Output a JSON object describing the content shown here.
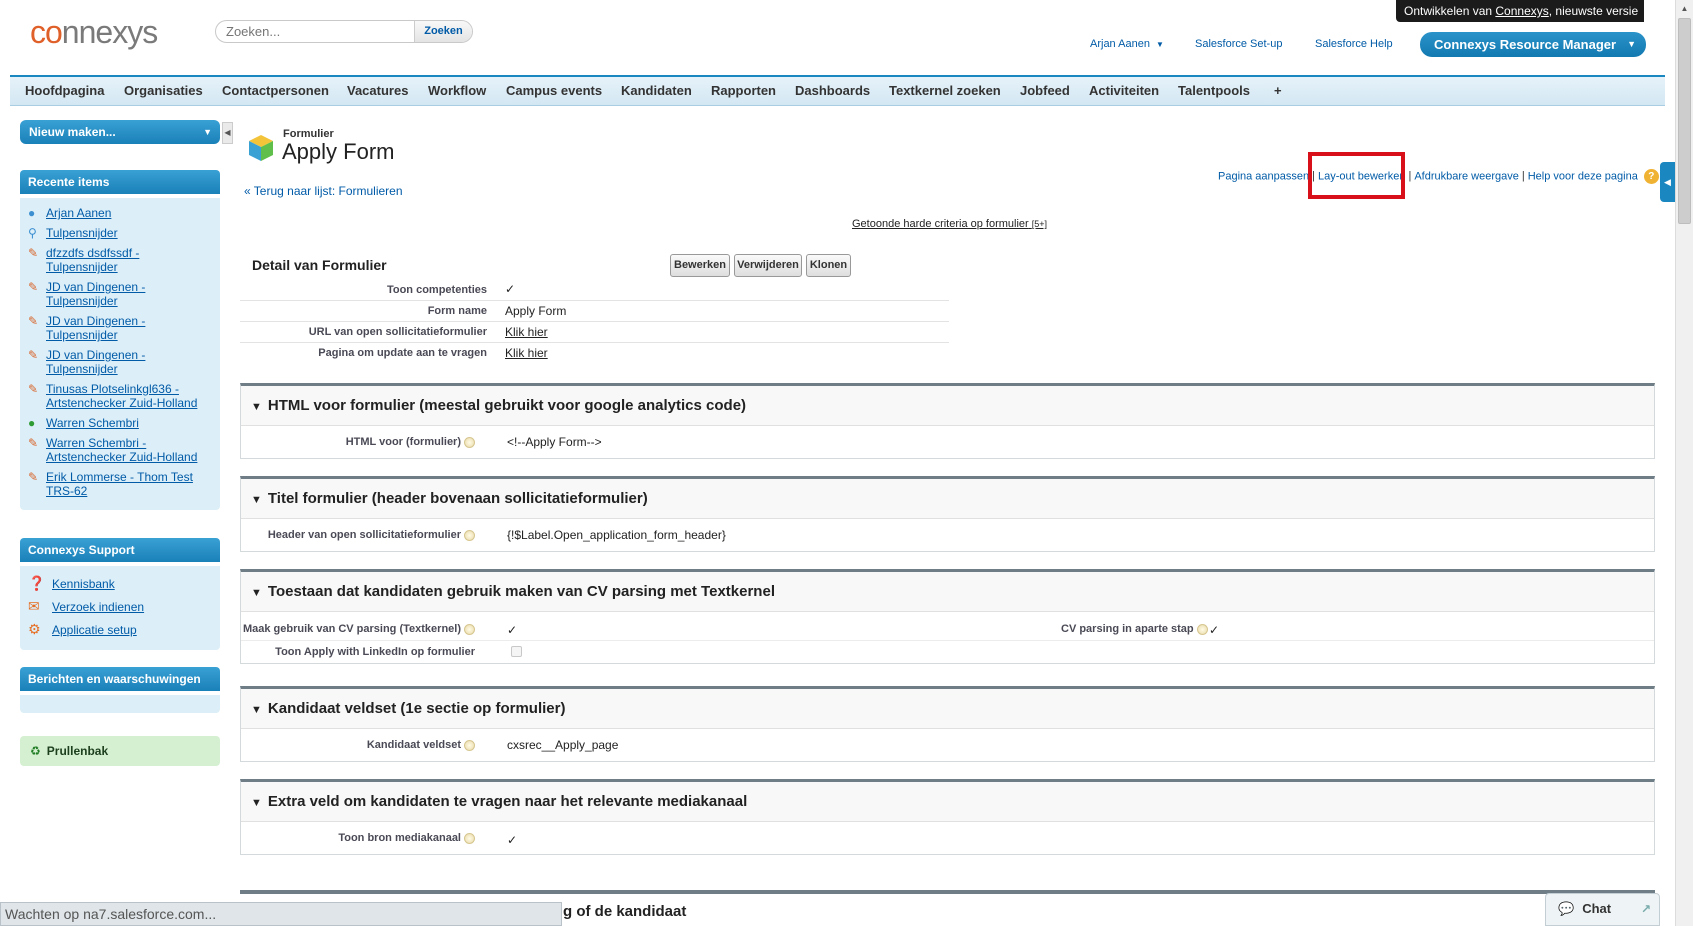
{
  "header": {
    "logo_pre": "co",
    "logo_rest": "nnexys",
    "search_placeholder": "Zoeken...",
    "search_button": "Zoeken",
    "dev_banner_pre": "Ontwikkelen van ",
    "dev_banner_link": "Connexys",
    "dev_banner_post": ", nieuwste versie",
    "user_name": "Arjan Aanen",
    "setup_link": "Salesforce Set-up",
    "help_link": "Salesforce Help",
    "app_menu": "Connexys Resource Manager"
  },
  "tabs": [
    "Hoofdpagina",
    "Organisaties",
    "Contactpersonen",
    "Vacatures",
    "Workflow",
    "Campus events",
    "Kandidaten",
    "Rapporten",
    "Dashboards",
    "Textkernel zoeken",
    "Jobfeed",
    "Activiteiten",
    "Talentpools",
    "+"
  ],
  "sidebar": {
    "new_button": "Nieuw maken...",
    "recent_title": "Recente items",
    "recent_items": [
      {
        "icon": "person-icon",
        "label": "Arjan Aanen"
      },
      {
        "icon": "search-icon",
        "label": "Tulpensnijder"
      },
      {
        "icon": "pencil-icon",
        "label": "dfzzdfs dsdfssdf - Tulpensnijder"
      },
      {
        "icon": "pencil-icon",
        "label": "JD van Dingenen - Tulpensnijder"
      },
      {
        "icon": "pencil-icon",
        "label": "JD van Dingenen - Tulpensnijder"
      },
      {
        "icon": "pencil-icon",
        "label": "JD van Dingenen - Tulpensnijder"
      },
      {
        "icon": "pencil-icon",
        "label": "Tinusas Plotselinkgl636 - Artstenchecker Zuid-Holland"
      },
      {
        "icon": "person-green-icon",
        "label": "Warren Schembri"
      },
      {
        "icon": "pencil-icon",
        "label": "Warren Schembri - Artstenchecker Zuid-Holland"
      },
      {
        "icon": "pencil-icon",
        "label": "Erik Lommerse - Thom Test TRS-62"
      }
    ],
    "support_title": "Connexys Support",
    "support_items": [
      "Kennisbank",
      "Verzoek indienen",
      "Applicatie setup"
    ],
    "messages_title": "Berichten en waarschuwingen",
    "trash_label": "Prullenbak"
  },
  "page": {
    "type_label": "Formulier",
    "title": "Apply Form",
    "back_link": "« Terug naar lijst: Formulieren",
    "links": [
      "Pagina aanpassen",
      "Lay-out bewerken",
      "Afdrukbare weergave",
      "Help voor deze pagina"
    ],
    "criteria_text": "Getoonde harde criteria op formulier",
    "criteria_count": "[5+]",
    "detail_title": "Detail van Formulier",
    "buttons": [
      "Bewerken",
      "Verwijderen",
      "Klonen"
    ],
    "fields": [
      {
        "label": "Toon competenties",
        "value": "✓"
      },
      {
        "label": "Form name",
        "value": "Apply Form"
      },
      {
        "label": "URL van open sollicitatieformulier",
        "value": "Klik hier"
      },
      {
        "label": "Pagina om update aan te vragen",
        "value": "Klik hier"
      }
    ]
  },
  "sections": [
    {
      "title": "HTML voor formulier (meestal gebruikt voor google analytics code)",
      "rows": [
        {
          "label": "HTML voor (formulier)",
          "value": "<!--Apply Form-->"
        }
      ]
    },
    {
      "title": "Titel formulier (header bovenaan sollicitatieformulier)",
      "rows": [
        {
          "label": "Header van open sollicitatieformulier",
          "value": "{!$Label.Open_application_form_header}"
        }
      ]
    },
    {
      "title": "Toestaan dat kandidaten gebruik maken van CV parsing met Textkernel",
      "rows": [
        {
          "label": "Maak gebruik van CV parsing (Textkernel)",
          "value": "✓",
          "label2": "CV parsing in aparte stap",
          "value2": "✓"
        },
        {
          "label": "Toon Apply with LinkedIn op formulier",
          "value": ""
        }
      ]
    },
    {
      "title": "Kandidaat veldset (1e sectie op formulier)",
      "rows": [
        {
          "label": "Kandidaat veldset",
          "value": "cxsrec__Apply_page"
        }
      ]
    },
    {
      "title": "Extra veld om kandidaten te vragen naar het relevante mediakanaal",
      "rows": [
        {
          "label": "Toon bron mediakanaal",
          "value": "✓"
        }
      ]
    }
  ],
  "bottom": {
    "status_text": "Wachten op na7.salesforce.com...",
    "partial_heading": "g of de kandidaat",
    "chat_label": "Chat"
  }
}
